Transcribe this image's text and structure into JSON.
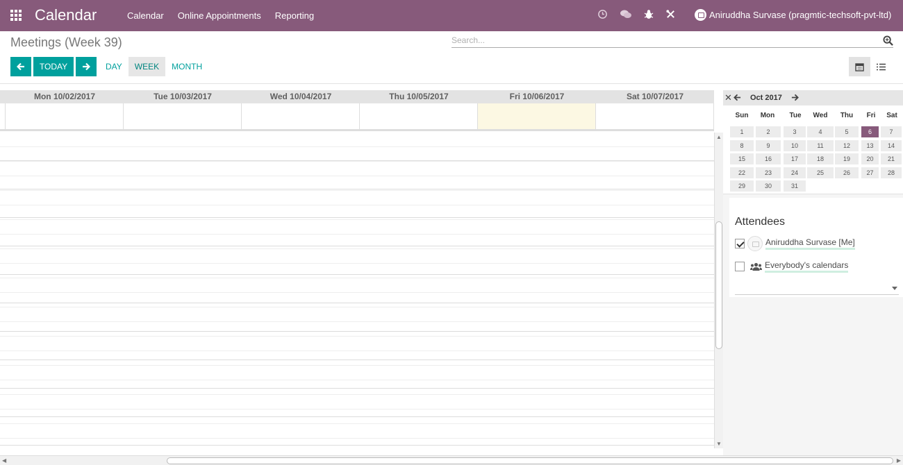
{
  "navbar": {
    "brand": "Calendar",
    "menu": [
      "Calendar",
      "Online Appointments",
      "Reporting"
    ],
    "icons": [
      "clock-icon",
      "chat-icon",
      "bug-icon",
      "tools-icon"
    ],
    "user": "Aniruddha Survase (pragmtic-techsoft-pvt-ltd)",
    "color": "#875a7b"
  },
  "control": {
    "title": "Meetings (Week 39)",
    "search_placeholder": "Search...",
    "today": "TODAY",
    "scales": [
      "DAY",
      "WEEK",
      "MONTH"
    ],
    "active_scale": "WEEK",
    "accent": "#00a09d"
  },
  "week": {
    "days": [
      "Mon 10/02/2017",
      "Tue 10/03/2017",
      "Wed 10/04/2017",
      "Thu 10/05/2017",
      "Fri 10/06/2017",
      "Sat 10/07/2017"
    ],
    "today": "Fri 10/06/2017"
  },
  "mini_calendar": {
    "month": "Oct 2017",
    "dow": [
      "Sun",
      "Mon",
      "Tue",
      "Wed",
      "Thu",
      "Fri",
      "Sat"
    ],
    "weeks": [
      [
        "1",
        "2",
        "3",
        "4",
        "5",
        "6",
        "7"
      ],
      [
        "8",
        "9",
        "10",
        "11",
        "12",
        "13",
        "14"
      ],
      [
        "15",
        "16",
        "17",
        "18",
        "19",
        "20",
        "21"
      ],
      [
        "22",
        "23",
        "24",
        "25",
        "26",
        "27",
        "28"
      ],
      [
        "29",
        "30",
        "31"
      ]
    ],
    "selected": "6"
  },
  "attendees": {
    "title": "Attendees",
    "items": [
      {
        "name": "Aniruddha Survase [Me]",
        "checked": true
      },
      {
        "name": "Everybody's calendars",
        "checked": false
      }
    ]
  }
}
